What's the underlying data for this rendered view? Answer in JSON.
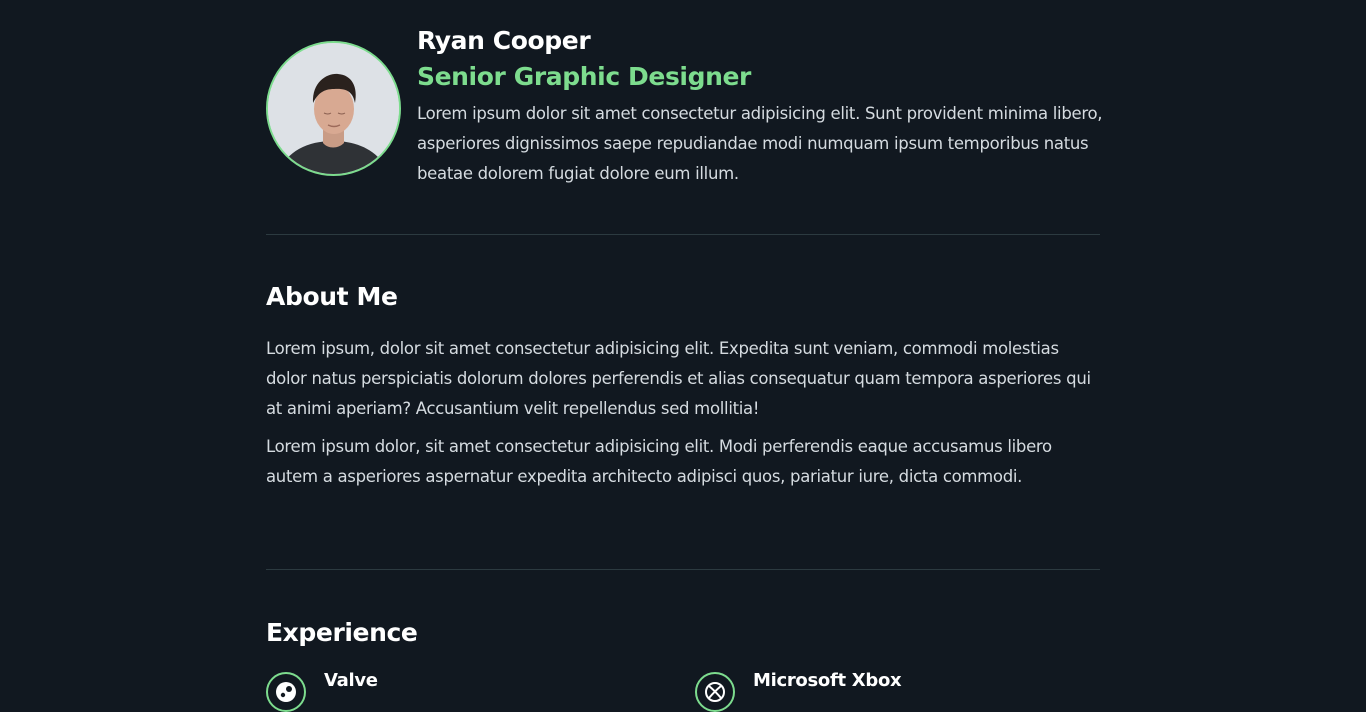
{
  "profile": {
    "name": "Ryan Cooper",
    "role": "Senior Graphic Designer",
    "intro": "Lorem ipsum dolor sit amet consectetur adipisicing elit. Sunt provident minima libero, asperiores dignissimos saepe repudiandae modi numquam ipsum temporibus natus beatae dolorem fugiat dolore eum illum."
  },
  "about": {
    "title": "About Me",
    "paragraphs": [
      "Lorem ipsum, dolor sit amet consectetur adipisicing elit. Expedita sunt veniam, commodi molestias dolor natus perspiciatis dolorum dolores perferendis et alias consequatur quam tempora asperiores qui at animi aperiam? Accusantium velit repellendus sed mollitia!",
      "Lorem ipsum dolor, sit amet consectetur adipisicing elit. Modi perferendis eaque accusamus libero autem a asperiores aspernatur expedita architecto adipisci quos, pariatur iure, dicta commodi."
    ]
  },
  "experience": {
    "title": "Experience",
    "items": [
      {
        "company": "Valve",
        "icon": "steam-icon"
      },
      {
        "company": "Microsoft Xbox",
        "icon": "xbox-icon"
      }
    ]
  },
  "colors": {
    "background": "#111820",
    "accent": "#7ddc8e",
    "text": "#d5dbe0",
    "divider": "#2c3a40"
  }
}
